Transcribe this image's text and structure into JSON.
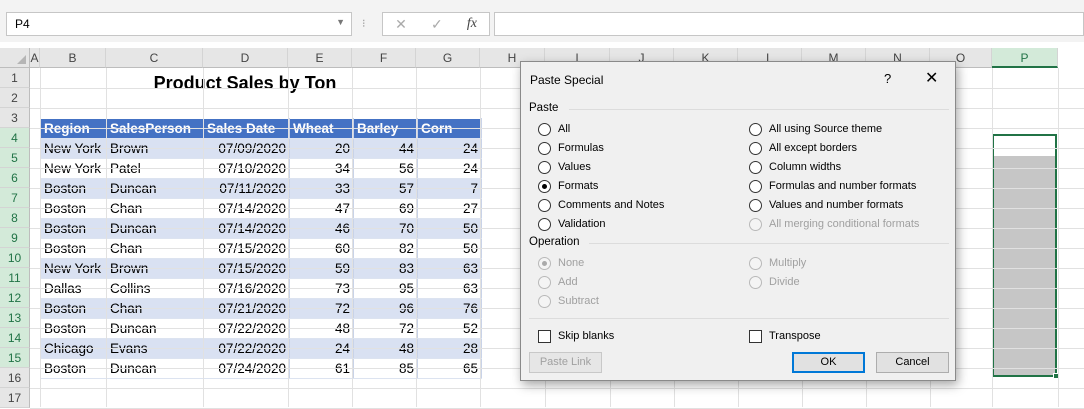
{
  "formula_bar": {
    "name_box": "P4",
    "sep": "⁝",
    "cancel_icon": "✕",
    "enter_icon": "✓",
    "fx_label": "fx"
  },
  "columns": [
    "A",
    "B",
    "C",
    "D",
    "E",
    "F",
    "G",
    "H",
    "I",
    "J",
    "K",
    "L",
    "M",
    "N",
    "O",
    "P"
  ],
  "selected_column": "P",
  "rows": [
    "1",
    "2",
    "3",
    "4",
    "5",
    "6",
    "7",
    "8",
    "9",
    "10",
    "11",
    "12",
    "13",
    "14",
    "15",
    "16",
    "17"
  ],
  "selected_rows": [
    "4",
    "5",
    "6",
    "7",
    "8",
    "9",
    "10",
    "11",
    "12",
    "13",
    "14",
    "15"
  ],
  "sheet": {
    "title": "Product Sales by Ton",
    "headers": [
      "Region",
      "SalesPerson",
      "Sales Date",
      "Wheat",
      "Barley",
      "Corn"
    ],
    "data": [
      [
        "New York",
        "Brown",
        "07/09/2020",
        "20",
        "44",
        "24"
      ],
      [
        "New York",
        "Patel",
        "07/10/2020",
        "34",
        "56",
        "24"
      ],
      [
        "Boston",
        "Duncan",
        "07/11/2020",
        "33",
        "57",
        "7"
      ],
      [
        "Boston",
        "Chan",
        "07/14/2020",
        "47",
        "69",
        "27"
      ],
      [
        "Boston",
        "Duncan",
        "07/14/2020",
        "46",
        "70",
        "50"
      ],
      [
        "Boston",
        "Chan",
        "07/15/2020",
        "60",
        "82",
        "50"
      ],
      [
        "New York",
        "Brown",
        "07/15/2020",
        "59",
        "83",
        "63"
      ],
      [
        "Dallas",
        "Collins",
        "07/16/2020",
        "73",
        "95",
        "63"
      ],
      [
        "Boston",
        "Chan",
        "07/21/2020",
        "72",
        "96",
        "76"
      ],
      [
        "Boston",
        "Duncan",
        "07/22/2020",
        "48",
        "72",
        "52"
      ],
      [
        "Chicago",
        "Evans",
        "07/22/2020",
        "24",
        "48",
        "28"
      ],
      [
        "Boston",
        "Duncan",
        "07/24/2020",
        "61",
        "85",
        "65"
      ]
    ]
  },
  "colors": {
    "header_fill": "#4472c4",
    "band_fill": "#d9e1f2",
    "selection": "#217346"
  },
  "dialog": {
    "title": "Paste Special",
    "help": "?",
    "close": "✕",
    "paste_label": "Paste",
    "paste_left": [
      {
        "label": "All",
        "checked": false,
        "disabled": false
      },
      {
        "label": "Formulas",
        "checked": false,
        "disabled": false
      },
      {
        "label": "Values",
        "checked": false,
        "disabled": false
      },
      {
        "label": "Formats",
        "checked": true,
        "disabled": false
      },
      {
        "label": "Comments and Notes",
        "checked": false,
        "disabled": false
      },
      {
        "label": "Validation",
        "checked": false,
        "disabled": false
      }
    ],
    "paste_right": [
      {
        "label": "All using Source theme",
        "checked": false,
        "disabled": false
      },
      {
        "label": "All except borders",
        "checked": false,
        "disabled": false
      },
      {
        "label": "Column widths",
        "checked": false,
        "disabled": false
      },
      {
        "label": "Formulas and number formats",
        "checked": false,
        "disabled": false
      },
      {
        "label": "Values and number formats",
        "checked": false,
        "disabled": false
      },
      {
        "label": "All merging conditional formats",
        "checked": false,
        "disabled": true
      }
    ],
    "operation_label": "Operation",
    "op_left": [
      {
        "label": "None",
        "checked": true,
        "disabled": true
      },
      {
        "label": "Add",
        "checked": false,
        "disabled": true
      },
      {
        "label": "Subtract",
        "checked": false,
        "disabled": true
      }
    ],
    "op_right": [
      {
        "label": "Multiply",
        "checked": false,
        "disabled": true
      },
      {
        "label": "Divide",
        "checked": false,
        "disabled": true
      }
    ],
    "skip_blanks": "Skip blanks",
    "transpose": "Transpose",
    "paste_link": "Paste Link",
    "ok": "OK",
    "cancel": "Cancel"
  }
}
